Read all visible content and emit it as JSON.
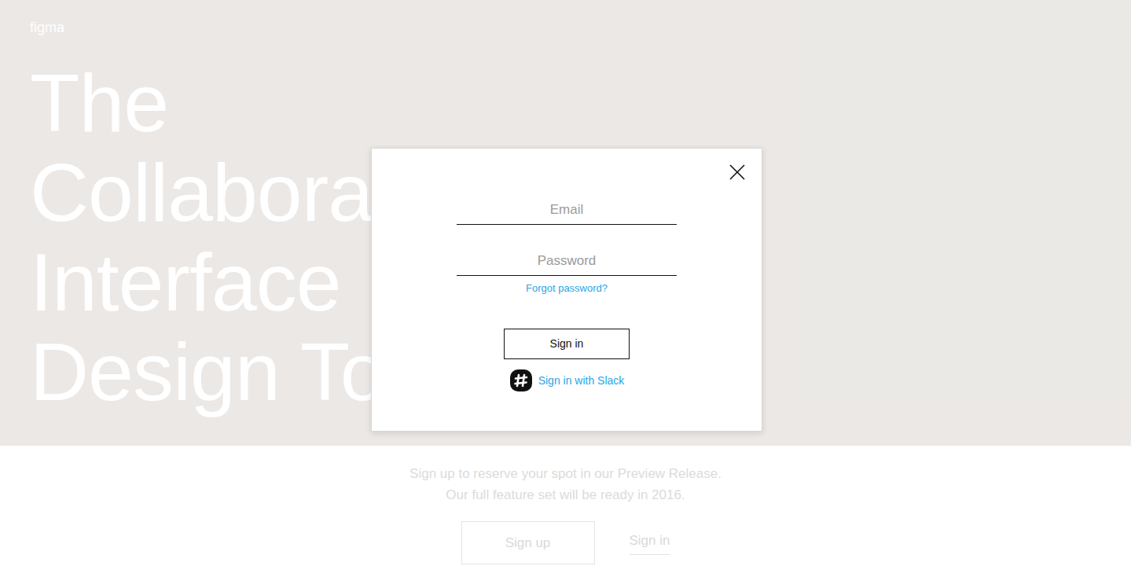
{
  "logo": "figma",
  "headline": [
    "The",
    "Collabora",
    "Interface",
    "Design To"
  ],
  "signup_text": [
    "Sign up to reserve your spot in our Preview Release.",
    "Our full feature set will be ready in 2016."
  ],
  "page_buttons": {
    "signup": "Sign up",
    "signin": "Sign in"
  },
  "modal": {
    "fields": [
      {
        "name": "email",
        "placeholder": "Email"
      },
      {
        "name": "password",
        "placeholder": "Password"
      }
    ],
    "forgot": "Forgot password?",
    "submit": "Sign in",
    "slack": "Sign in with Slack"
  }
}
